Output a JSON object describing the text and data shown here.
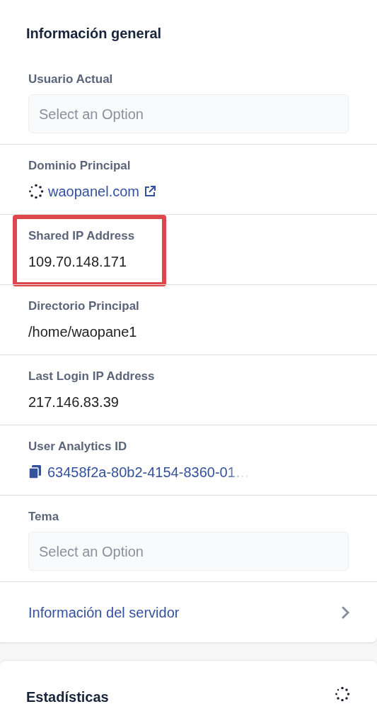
{
  "general_card": {
    "title": "Información general",
    "fields": [
      {
        "kind": "select",
        "label": "Usuario Actual",
        "placeholder": "Select an Option",
        "highlighted": false
      },
      {
        "kind": "link",
        "label": "Dominio Principal",
        "value": "waopanel.com",
        "highlighted": false
      },
      {
        "kind": "text",
        "label": "Shared IP Address",
        "value": "109.70.148.171",
        "highlighted": true
      },
      {
        "kind": "text",
        "label": "Directorio Principal",
        "value": "/home/waopane1",
        "highlighted": false
      },
      {
        "kind": "text",
        "label": "Last Login IP Address",
        "value": "217.146.83.39",
        "highlighted": false
      },
      {
        "kind": "copy",
        "label": "User Analytics ID",
        "value": "63458f2a-80b2-4154-8360-01…",
        "highlighted": false
      },
      {
        "kind": "select",
        "label": "Tema",
        "placeholder": "Select an Option",
        "highlighted": false
      }
    ],
    "server_link": "Información del servidor"
  },
  "stats_card": {
    "title": "Estadísticas"
  }
}
